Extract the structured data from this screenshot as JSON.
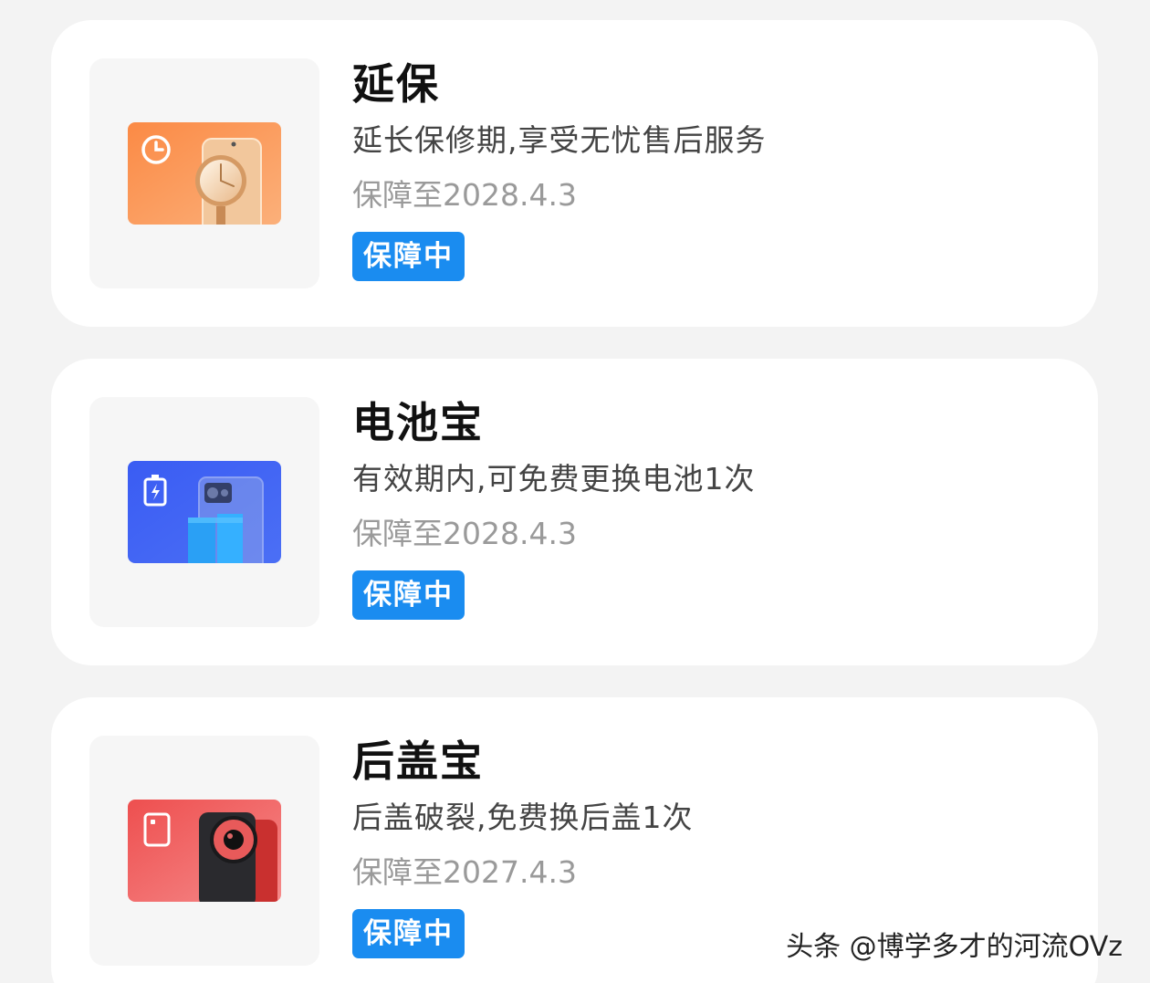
{
  "cards": [
    {
      "title": "延保",
      "description": "延长保修期,享受无忧售后服务",
      "expiry": "保障至2028.4.3",
      "status": "保障中",
      "icon": "clock-icon",
      "thumb_color": "#f98d4c"
    },
    {
      "title": "电池宝",
      "description": "有效期内,可免费更换电池1次",
      "expiry": "保障至2028.4.3",
      "status": "保障中",
      "icon": "battery-icon",
      "thumb_color": "#3d5ff2"
    },
    {
      "title": "后盖宝",
      "description": "后盖破裂,免费换后盖1次",
      "expiry": "保障至2027.4.3",
      "status": "保障中",
      "icon": "back-cover-icon",
      "thumb_color": "#ee5a5a"
    }
  ],
  "watermark": "头条 @博学多才的河流OVz",
  "colors": {
    "badge": "#1a8cf0",
    "background": "#f3f3f3",
    "card": "#ffffff"
  }
}
